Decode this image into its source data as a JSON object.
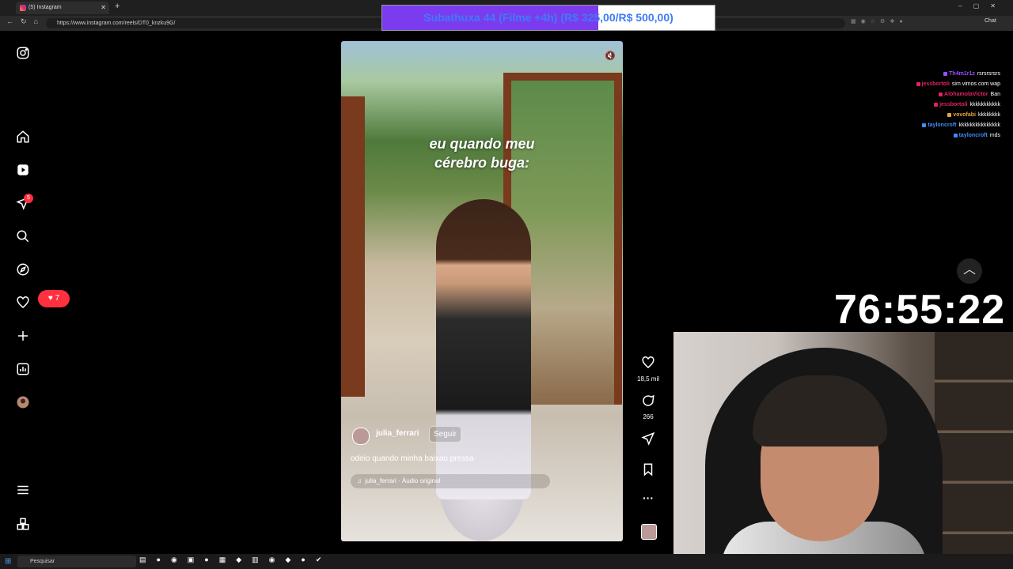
{
  "browser": {
    "tab_title": "(5) Instagram",
    "url": "https://www.instagram.com/reels/DT0_knzku9G/",
    "chat_button": "Chat"
  },
  "goal_bar": {
    "text": "Subathuxa 44 (Filme +4h) (R$ 325,00/R$ 500,00)",
    "progress_fraction": 0.65,
    "fill_color": "#7b3cf0",
    "text_color": "#3f7bf5"
  },
  "instagram": {
    "notifications_badge": "5",
    "likes_badge": "7",
    "video": {
      "caption_line1": "eu quando meu",
      "caption_line2": "cérebro buga:",
      "username": "julia_ferrari",
      "follow_label": "Seguir",
      "description": "odeio quando minha baixao pressa",
      "audio": "julia_ferrari · Áudio original"
    },
    "actions": {
      "likes": "18,5 mil",
      "comments": "266"
    }
  },
  "stream_chat": [
    {
      "user": "Th4m1r1z",
      "msg": "rsrsrsrsrs",
      "color": "#9b4dff"
    },
    {
      "user": "jessbortoli",
      "msg": "sim vimos com wap",
      "color": "#e0245e"
    },
    {
      "user": "AlohamolaVictor",
      "msg": "Ban",
      "color": "#e0245e"
    },
    {
      "user": "jessbortoli",
      "msg": "kkkkkkkkkkk",
      "color": "#e0245e"
    },
    {
      "user": "vovofabi",
      "msg": "kkkkkkkk",
      "color": "#e8a33d"
    },
    {
      "user": "tayloncroft",
      "msg": "kkkkkkkkkkkkkkk",
      "color": "#3f8cf5"
    },
    {
      "user": "tayloncroft",
      "msg": "mds",
      "color": "#3f8cf5"
    }
  ],
  "timer": "76:55:22",
  "taskbar": {
    "search_placeholder": "Pesquisar"
  }
}
